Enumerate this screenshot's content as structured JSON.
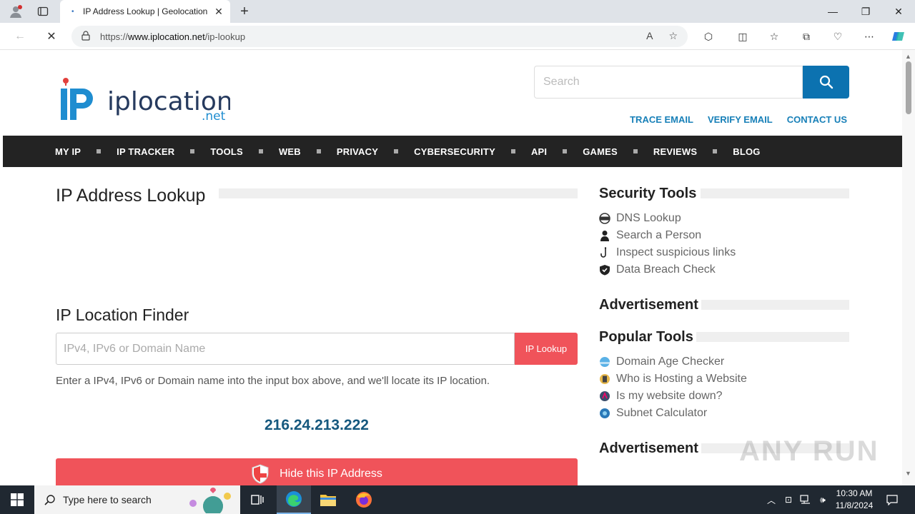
{
  "browser": {
    "tab_title": "IP Address Lookup | Geolocation",
    "url_prefix": "https://",
    "url_domain": "www.iplocation.net",
    "url_path": "/ip-lookup"
  },
  "site": {
    "logo_text": "iplocation",
    "logo_suffix": ".net",
    "search_placeholder": "Search",
    "top_links": [
      "TRACE EMAIL",
      "VERIFY EMAIL",
      "CONTACT US"
    ],
    "nav": [
      "MY IP",
      "IP TRACKER",
      "TOOLS",
      "WEB",
      "PRIVACY",
      "CYBERSECURITY",
      "API",
      "GAMES",
      "REVIEWS",
      "BLOG"
    ]
  },
  "main": {
    "title": "IP Address Lookup",
    "finder_title": "IP Location Finder",
    "finder_placeholder": "IPv4, IPv6 or Domain Name",
    "finder_button": "IP Lookup",
    "help_text": "Enter a IPv4, IPv6 or Domain name into the input box above, and we'll locate its IP location.",
    "my_ip": "216.24.213.222",
    "hide_button": "Hide this IP Address"
  },
  "sidebar": {
    "security_title": "Security Tools",
    "security_items": [
      "DNS Lookup",
      "Search a Person",
      "Inspect suspicious links",
      "Data Breach Check"
    ],
    "ad_label_1": "Advertisement",
    "popular_title": "Popular Tools",
    "popular_items": [
      "Domain Age Checker",
      "Who is Hosting a Website",
      "Is my website down?",
      "Subnet Calculator"
    ],
    "ad_label_2": "Advertisement"
  },
  "watermark": "ANY RUN",
  "taskbar": {
    "search_placeholder": "Type here to search",
    "time": "10:30 AM",
    "date": "11/8/2024"
  },
  "colors": {
    "brand_blue": "#0c72b0",
    "link_blue": "#1880b8",
    "accent_red": "#f0535a",
    "nav_dark": "#232323",
    "ip_color": "#15587e"
  }
}
